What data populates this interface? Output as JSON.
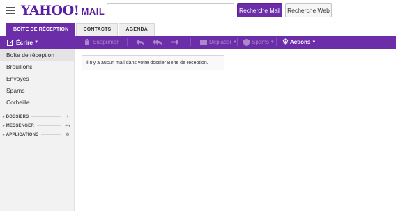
{
  "header": {
    "logo_brand": "YAHOO!",
    "logo_product": "MAIL",
    "search_placeholder": "",
    "search_mail_label": "Recherche Mail",
    "search_web_label": "Recherche Web"
  },
  "tabs": [
    {
      "label": "BOÎTE DE RÉCEPTION",
      "active": true
    },
    {
      "label": "CONTACTS",
      "active": false
    },
    {
      "label": "AGENDA",
      "active": false
    }
  ],
  "toolbar": {
    "compose_label": "Écrire",
    "delete_label": "Supprimer",
    "move_label": "Déplacer",
    "spam_label": "Spams",
    "actions_label": "Actions"
  },
  "sidebar": {
    "folders": [
      {
        "label": "Boîte de réception",
        "selected": true
      },
      {
        "label": "Brouillons",
        "selected": false
      },
      {
        "label": "Envoyés",
        "selected": false
      },
      {
        "label": "Spams",
        "selected": false
      },
      {
        "label": "Corbeille",
        "selected": false
      }
    ],
    "sections": [
      {
        "label": "DOSSIERS",
        "icon": "plus-icon"
      },
      {
        "label": "MESSENGER",
        "icon": "status-icon"
      },
      {
        "label": "APPLICATIONS",
        "icon": "gear-icon"
      }
    ]
  },
  "main": {
    "empty_message": "Il n'y a aucun mail dans votre dossier Boîte de réception."
  },
  "colors": {
    "accent": "#6b2ea8",
    "sidebar_bg": "#f2f2f2"
  }
}
